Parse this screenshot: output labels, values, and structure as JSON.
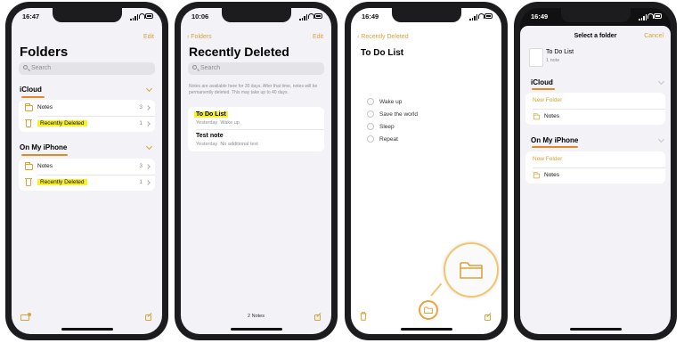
{
  "phone1": {
    "time": "16:47",
    "edit": "Edit",
    "title": "Folders",
    "search_placeholder": "Search",
    "sections": [
      {
        "name": "iCloud",
        "items": [
          {
            "label": "Notes",
            "count": "3"
          },
          {
            "label": "Recently Deleted",
            "count": "1"
          }
        ]
      },
      {
        "name": "On My iPhone",
        "items": [
          {
            "label": "Notes",
            "count": "3"
          },
          {
            "label": "Recently Deleted",
            "count": "1"
          }
        ]
      }
    ],
    "icons": {
      "new_folder": "folder-badge-plus-icon",
      "compose": "compose-icon"
    }
  },
  "phone2": {
    "time": "10:06",
    "back": "Folders",
    "edit": "Edit",
    "title": "Recently Deleted",
    "search_placeholder": "Search",
    "info": "Notes are available here for 30 days. After that time, notes will be permanently deleted. This may take up to 40 days.",
    "notes": [
      {
        "title": "To Do List",
        "date": "Yesterday",
        "preview": "Wake up"
      },
      {
        "title": "Test note",
        "date": "Yesterday",
        "preview": "No additional text"
      }
    ],
    "footer": "2 Notes"
  },
  "phone3": {
    "time": "16:49",
    "back": "Recently Deleted",
    "title": "To Do List",
    "checklist": [
      "Wake up",
      "Save the world",
      "Sleep",
      "Repeat"
    ],
    "icons": {
      "trash": "trash-icon",
      "move_to_folder": "folder-icon",
      "compose": "compose-icon"
    }
  },
  "phone4": {
    "time": "16:49",
    "header": "Select a folder",
    "cancel": "Cancel",
    "note_title": "To Do List",
    "note_sub": "1 note",
    "sections": [
      {
        "name": "iCloud",
        "new_folder": "New Folder",
        "folder": "Notes"
      },
      {
        "name": "On My iPhone",
        "new_folder": "New Folder",
        "folder": "Notes"
      }
    ]
  },
  "colors": {
    "accent": "#d9a33a",
    "highlight": "#f6f02e",
    "underline": "#e08a2c"
  }
}
